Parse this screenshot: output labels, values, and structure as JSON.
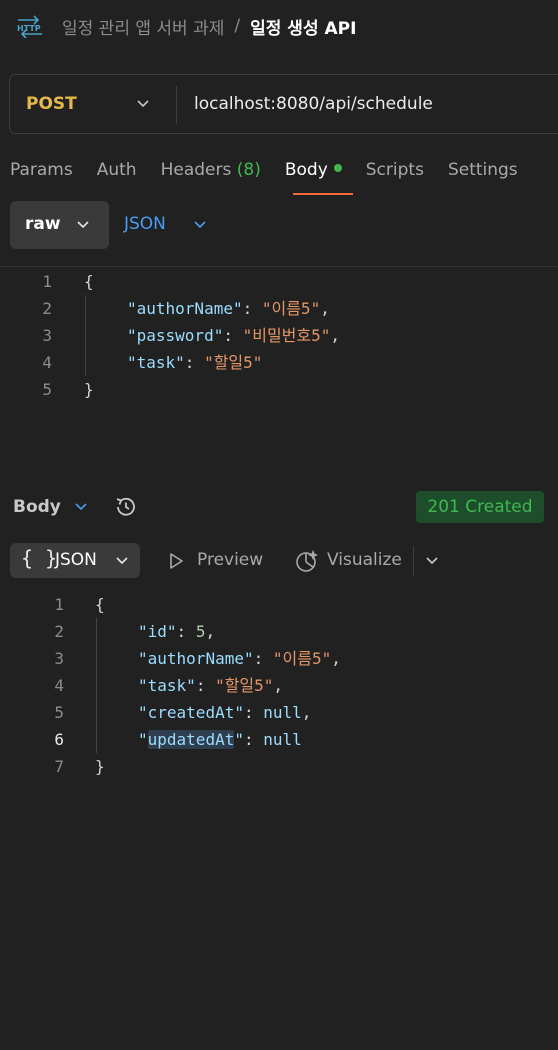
{
  "header": {
    "breadcrumb_parent": "일정 관리 앱 서버 과제",
    "separator": "/",
    "current_request": "일정 생성 API"
  },
  "request": {
    "method": "POST",
    "url": "localhost:8080/api/schedule"
  },
  "tabs": [
    {
      "label": "Params"
    },
    {
      "label": "Auth"
    },
    {
      "label": "Headers",
      "count": "(8)"
    },
    {
      "label": "Body",
      "active": true
    },
    {
      "label": "Scripts"
    },
    {
      "label": "Settings"
    }
  ],
  "body_mode": {
    "type": "raw",
    "format": "JSON"
  },
  "request_body": {
    "line_numbers": [
      "1",
      "2",
      "3",
      "4",
      "5"
    ],
    "open_brace": "{",
    "close_brace": "}",
    "fields": [
      {
        "key": "\"authorName\"",
        "value": "\"이름5\"",
        "comma": ","
      },
      {
        "key": "\"password\"",
        "value": "\"비밀번호5\"",
        "comma": ","
      },
      {
        "key": "\"task\"",
        "value": "\"할일5\"",
        "comma": ""
      }
    ]
  },
  "response": {
    "section_label": "Body",
    "status": "201 Created",
    "view_format": "JSON",
    "braces_icon": "{ }",
    "preview_label": "Preview",
    "visualize_label": "Visualize",
    "line_numbers": [
      "1",
      "2",
      "3",
      "4",
      "5",
      "6",
      "7"
    ],
    "open_brace": "{",
    "close_brace": "}",
    "fields": [
      {
        "key": "id",
        "value": "5",
        "value_type": "number",
        "comma": ","
      },
      {
        "key": "authorName",
        "value": "\"이름5\"",
        "value_type": "string",
        "comma": ","
      },
      {
        "key": "task",
        "value": "\"할일5\"",
        "value_type": "string",
        "comma": ","
      },
      {
        "key": "createdAt",
        "value": "null",
        "value_type": "null",
        "comma": ","
      },
      {
        "key": "updatedAt",
        "value": "null",
        "value_type": "null",
        "comma": ""
      }
    ]
  },
  "colors": {
    "method": "#e5b84a",
    "status_text": "#3fb950",
    "status_bg": "#1e4d2b",
    "active_tab_underline": "#f26b3a",
    "json_format": "#4b9cf5"
  },
  "icons": [
    "http-icon",
    "chevron-down-icon",
    "history-icon",
    "braces-icon",
    "play-icon",
    "visualize-icon"
  ]
}
